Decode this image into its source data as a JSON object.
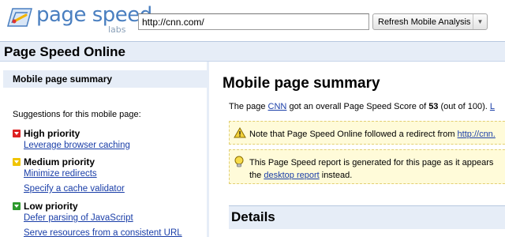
{
  "header": {
    "logo_text": "page speed",
    "logo_sub": "labs",
    "url_value": "http://cnn.com/",
    "analyze_label": "Refresh Mobile Analysis",
    "dropdown_glyph": "▼"
  },
  "titlebar": {
    "title": "Page Speed Online"
  },
  "sidebar": {
    "selected_item": "Mobile page summary",
    "suggestions_title": "Suggestions for this mobile page:",
    "high": {
      "label": "High priority",
      "rules": [
        "Leverage browser caching"
      ]
    },
    "medium": {
      "label": "Medium priority",
      "rules": [
        "Minimize redirects",
        "Specify a cache validator"
      ]
    },
    "low": {
      "label": "Low priority",
      "rules": [
        "Defer parsing of JavaScript",
        "Serve resources from a consistent URL"
      ]
    }
  },
  "main": {
    "title": "Mobile page summary",
    "score_prefix": "The page ",
    "site_link": "CNN",
    "score_middle": " got an overall Page Speed Score of ",
    "score": "53",
    "score_suffix": " (out of 100). ",
    "score_trailing_link": "L",
    "redirect_notice_text": "Note that Page Speed Online followed a redirect from ",
    "redirect_link": "http://cnn.",
    "desktop_notice_line1": "This Page Speed report is generated for this page as it appears",
    "desktop_notice_pre": "the ",
    "desktop_link": "desktop report",
    "desktop_notice_post": " instead.",
    "details_title": "Details"
  },
  "colors": {
    "accent_blue": "#4a7fc0",
    "link": "#1a3ea8",
    "panel_bg": "#e6edf7",
    "high": "#dd2222",
    "medium": "#f0c400",
    "low": "#2d9a2d",
    "notice_bg": "#fffbd9"
  },
  "icons": [
    "page-speed-logo-icon",
    "warning-icon",
    "lightbulb-icon",
    "dropdown-arrow-icon",
    "priority-flag-icon"
  ]
}
